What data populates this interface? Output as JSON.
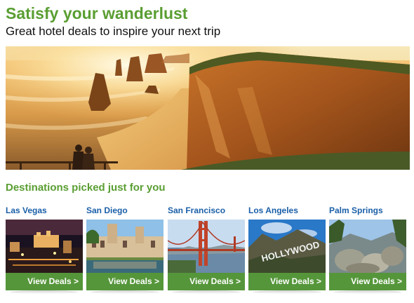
{
  "header": {
    "headline": "Satisfy your wanderlust",
    "subhead": "Great hotel deals to inspire your next trip"
  },
  "section": {
    "title": "Destinations picked just for you"
  },
  "destinations": [
    {
      "city": "Las Vegas",
      "button": "View Deals >"
    },
    {
      "city": "San Diego",
      "button": "View Deals >"
    },
    {
      "city": "San Francisco",
      "button": "View Deals >"
    },
    {
      "city": "Los Angeles",
      "button": "View Deals >"
    },
    {
      "city": "Palm Springs",
      "button": "View Deals >"
    }
  ],
  "photos": {
    "los_angeles_sign": "HOLLYWOOD"
  },
  "colors": {
    "brand_green": "#5a9e32",
    "button_green": "#55963a",
    "link_blue": "#1a5fa8"
  }
}
